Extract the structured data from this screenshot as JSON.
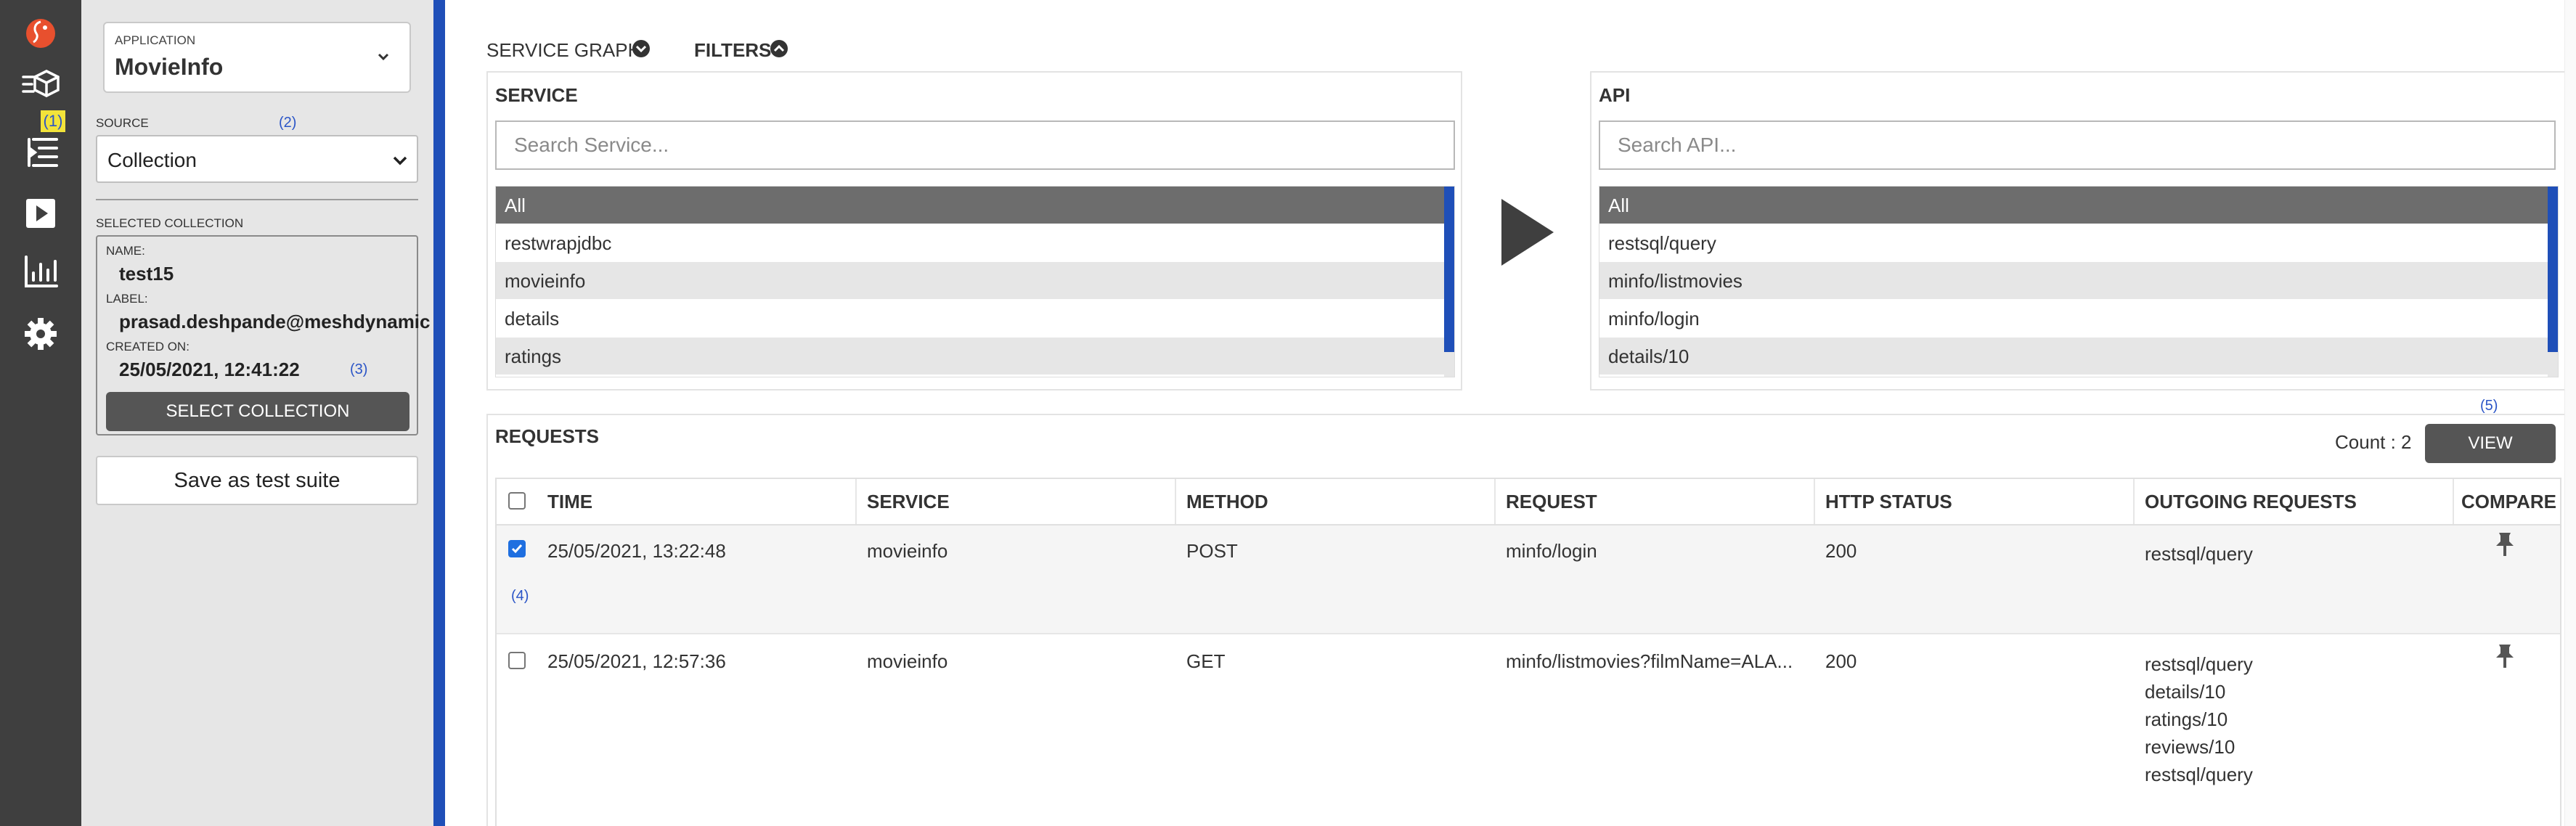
{
  "rail": {
    "badge": "(1)",
    "icons": [
      "logo-icon",
      "test-suite-icon",
      "test-list-icon",
      "run-icon",
      "analytics-icon",
      "settings-icon"
    ]
  },
  "sidebar": {
    "application": {
      "caption": "APPLICATION",
      "value": "MovieInfo"
    },
    "source": {
      "caption": "SOURCE",
      "hint": "(2)",
      "value": "Collection"
    },
    "selected_collection": {
      "caption": "SELECTED COLLECTION",
      "name_label": "NAME:",
      "name": "test15",
      "label_label": "LABEL:",
      "label": "prasad.deshpande@meshdynamic",
      "created_label": "CREATED ON:",
      "created": "25/05/2021, 12:41:22",
      "hint": "(3)",
      "select_button": "SELECT COLLECTION"
    },
    "save_button": "Save as test suite"
  },
  "toggles": {
    "service_graph": "SERVICE GRAPH",
    "filters": "FILTERS"
  },
  "service_panel": {
    "title": "SERVICE",
    "placeholder": "Search Service...",
    "items": [
      "All",
      "restwrapjdbc",
      "movieinfo",
      "details",
      "ratings"
    ]
  },
  "api_panel": {
    "title": "API",
    "placeholder": "Search API...",
    "items": [
      "All",
      "restsql/query",
      "minfo/listmovies",
      "minfo/login",
      "details/10"
    ]
  },
  "requests": {
    "title": "REQUESTS",
    "count": "Count : 2",
    "view_button": "VIEW",
    "view_hint": "(5)",
    "row_hint": "(4)",
    "columns": {
      "time": "TIME",
      "service": "SERVICE",
      "method": "METHOD",
      "request": "REQUEST",
      "status": "HTTP STATUS",
      "outgoing": "OUTGOING REQUESTS",
      "compare": "COMPARE"
    },
    "rows": [
      {
        "checked": true,
        "time": "25/05/2021, 13:22:48",
        "service": "movieinfo",
        "method": "POST",
        "request": "minfo/login",
        "status": "200",
        "outgoing": [
          "restsql/query"
        ]
      },
      {
        "checked": false,
        "time": "25/05/2021, 12:57:36",
        "service": "movieinfo",
        "method": "GET",
        "request": "minfo/listmovies?filmName=ALA...",
        "status": "200",
        "outgoing": [
          "restsql/query",
          "details/10",
          "ratings/10",
          "reviews/10",
          "restsql/query"
        ]
      }
    ]
  },
  "colors": {
    "rail": "#3f3f3f",
    "sidebar": "#e6e6e6",
    "accent_blue": "#1f4fb8",
    "button_dark": "#555555",
    "list_active": "#6d6d6d",
    "badge_yellow": "#f2e33a",
    "logo_orange": "#e8502e"
  }
}
